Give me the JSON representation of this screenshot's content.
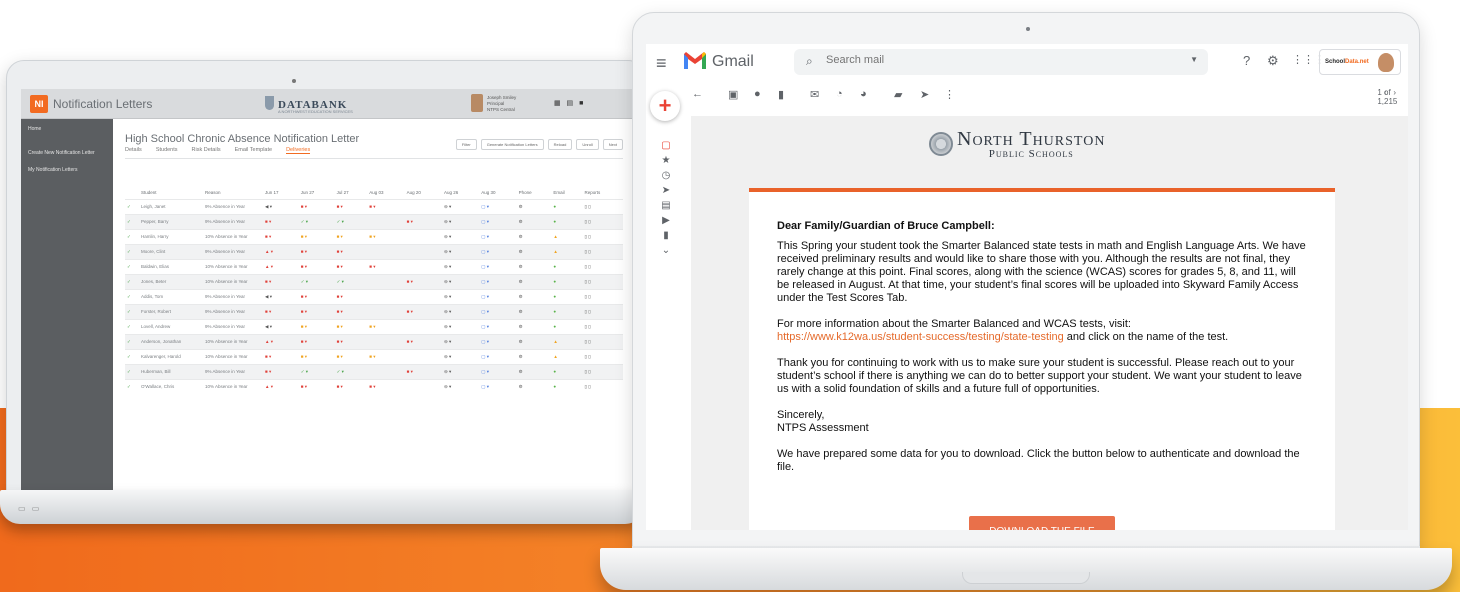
{
  "left_app": {
    "logo": "NI",
    "title": "Notification Letters",
    "brand": "DATABANK",
    "brand_sub": "A NORTHWEST EDUCATION SERVICES",
    "user_name": "Joseph Smiley",
    "user_role": "Principal",
    "user_school": "NTPS Central",
    "sidebar": [
      "Home",
      "Create New Notification Letter",
      "My Notification Letters"
    ],
    "page_title": "High School Chronic Absence Notification Letter",
    "action_buttons": [
      "Filter",
      "Generate Notification Letters",
      "Reload",
      "Unroll",
      "Next"
    ],
    "tabs": [
      "Details",
      "Students",
      "Risk Details",
      "Email Template",
      "Deliveries"
    ],
    "active_tab": "Deliveries",
    "columns": [
      "",
      "Student",
      "Reason",
      "Jun 17",
      "Jun 27",
      "Jul 27",
      "Aug 03",
      "Aug 20",
      "Aug 26",
      "Aug 30",
      "Phone",
      "Email",
      "Reports"
    ],
    "rows": [
      {
        "student": "Leigh, Janet",
        "reason": "9% Absence in Year"
      },
      {
        "student": "Pepper, Barry",
        "reason": "9% Absence in Year"
      },
      {
        "student": "Hamlin, Harry",
        "reason": "10% Absence in Year"
      },
      {
        "student": "Moore, Clint",
        "reason": "9% Absence in Year"
      },
      {
        "student": "Baldwin, Elias",
        "reason": "10% Absence in Year"
      },
      {
        "student": "Jones, Beter",
        "reason": "10% Absence in Year"
      },
      {
        "student": "Addis, Tom",
        "reason": "9% Absence in Year"
      },
      {
        "student": "Forster, Robert",
        "reason": "9% Absence in Year"
      },
      {
        "student": "Lovell, Andrew",
        "reason": "9% Absence in Year"
      },
      {
        "student": "Anderson, Jonathan",
        "reason": "10% Absence in Year"
      },
      {
        "student": "Kalvarenger, Harold",
        "reason": "10% Absence in Year"
      },
      {
        "student": "Huberman, Bill",
        "reason": "9% Absence in Year"
      },
      {
        "student": "O'Wallace, Chris",
        "reason": "10% Absence in Year"
      }
    ]
  },
  "gmail": {
    "app_name": "Gmail",
    "search_placeholder": "Search mail",
    "count": "1 of 1,215",
    "account_brand_a": "School",
    "account_brand_b": "Data.net",
    "district_line1": "North Thurston",
    "district_line2": "Public Schools",
    "greeting": "Dear Family/Guardian of Bruce Campbell:",
    "para1": "This Spring your student took the Smarter Balanced state tests in math and English Language Arts. We have received preliminary results and would like to share those with you. Although the results are not final, they rarely change at this point. Final scores, along with the science (WCAS) scores for grades 5, 8, and 11, will be released in August. At that time, your student’s final scores will be uploaded into Skyward Family Access under the Test Scores Tab.",
    "para2_a": "For more information about the Smarter Balanced and WCAS tests, visit:",
    "link": "https://www.k12wa.us/student-success/testing/state-testing",
    "para2_b": " and click on the name of the test.",
    "para3": "Thank you for continuing to work with us to make sure your student is successful. Please reach out to your student’s school if there is anything we can do to better support your student. We want your student to leave us with a solid foundation of skills and a future full of opportunities.",
    "sign1": "Sincerely,",
    "sign2": "NTPS Assessment",
    "para4": "We have prepared some data for you to download. Click the button below to authenticate and download the file.",
    "button": "DOWNLOAD THE FILE"
  },
  "colors": {
    "orange": "#f26b21",
    "gmail_red": "#ea4335",
    "link": "#e56a2b"
  }
}
